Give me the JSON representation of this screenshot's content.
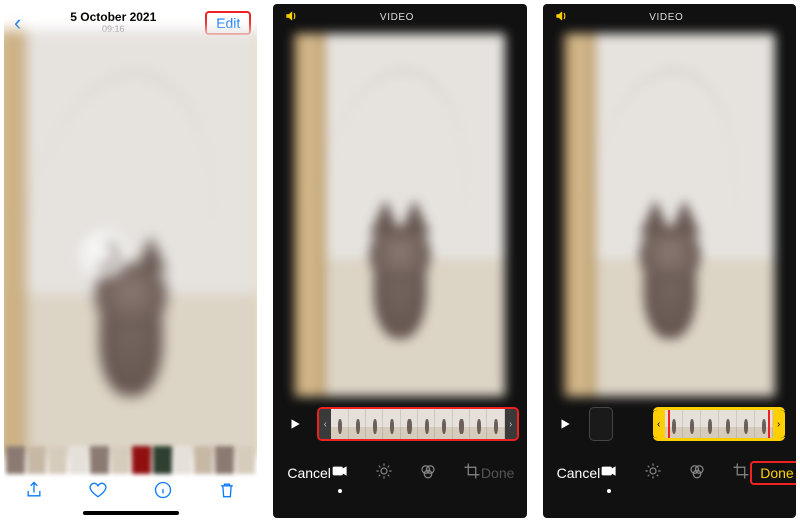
{
  "screen1": {
    "date": "5 October 2021",
    "time": "09:16",
    "edit_label": "Edit"
  },
  "editor": {
    "title": "VIDEO",
    "cancel_label": "Cancel",
    "done_label": "Done"
  }
}
